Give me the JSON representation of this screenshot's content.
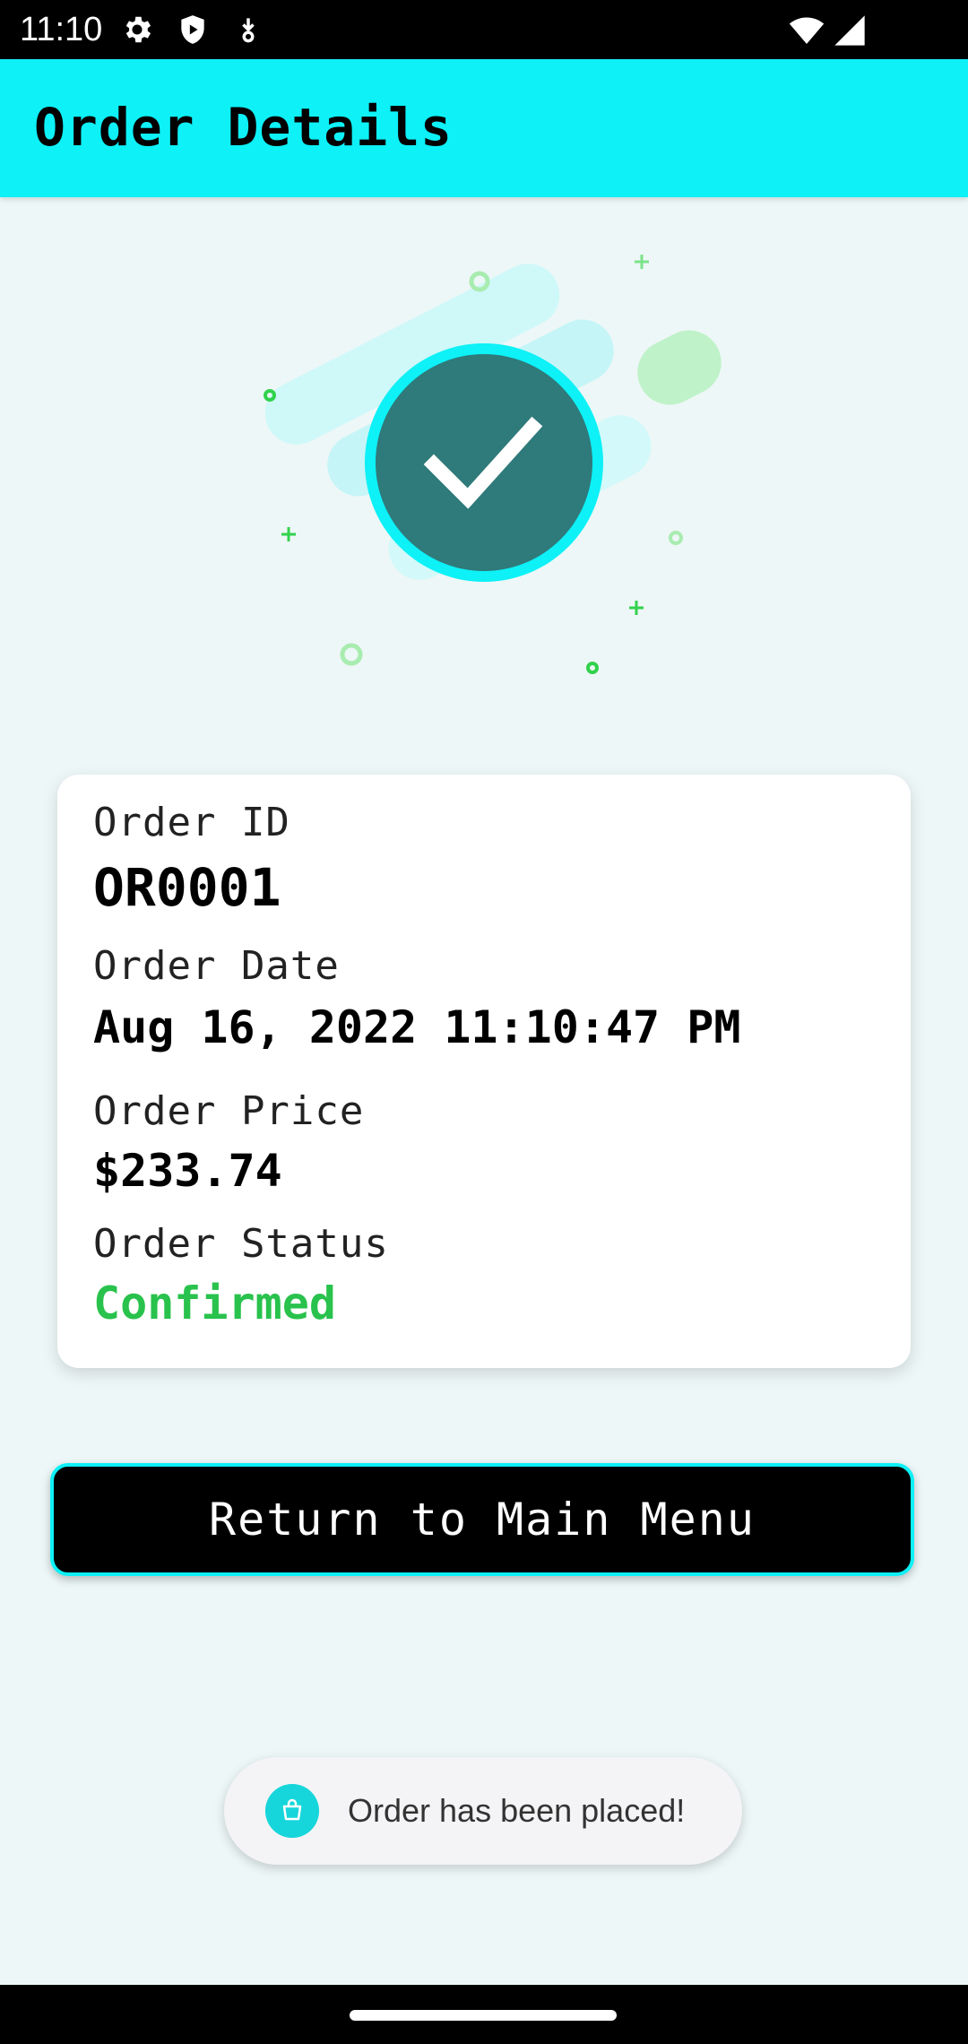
{
  "status_bar": {
    "time": "11:10",
    "icons": [
      "gear-icon",
      "shield-play-icon",
      "download-icon",
      "wifi-icon",
      "signal-icon"
    ]
  },
  "app_bar": {
    "title": "Order Details"
  },
  "illustration": {
    "icon": "checkmark-icon",
    "colors": {
      "circle": "#2f7a7a",
      "ring": "#0df1f7",
      "accent": "#32d24c"
    }
  },
  "order": {
    "id_label": "Order ID",
    "id_value": "OR0001",
    "date_label": "Order Date",
    "date_value": "Aug 16, 2022 11:10:47 PM",
    "price_label": "Order Price",
    "price_value": "$233.74",
    "status_label": "Order Status",
    "status_value": "Confirmed"
  },
  "actions": {
    "return_label": "Return to Main Menu"
  },
  "toast": {
    "icon": "shopping-bag-icon",
    "message": "Order has been placed!"
  },
  "colors": {
    "accent": "#0df1f7",
    "status_confirmed": "#28c24c",
    "background": "#edf7f7"
  }
}
